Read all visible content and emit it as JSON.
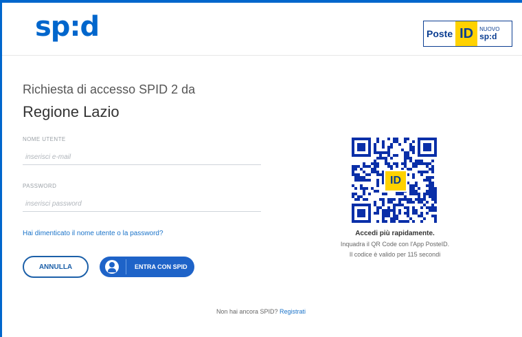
{
  "header": {
    "logo_text": "sp:d",
    "badge": {
      "poste": "Poste",
      "id": "ID",
      "nuovo": "NUOVO",
      "spid": "sp:d"
    }
  },
  "login": {
    "subtitle": "Richiesta di accesso SPID 2 da",
    "region": "Regione Lazio",
    "username_label": "NOME UTENTE",
    "username_placeholder": "inserisci e-mail",
    "password_label": "PASSWORD",
    "password_placeholder": "inserisci password",
    "forgot_link": "Hai dimenticato il nome utente o la password?",
    "cancel_label": "ANNULLA",
    "spid_button_label": "ENTRA CON SPID"
  },
  "qr": {
    "center_label": "ID",
    "title": "Accedi più rapidamente.",
    "line1": "Inquadra il QR Code con l'App PosteID.",
    "line2": "Il codice è valido per 115 secondi"
  },
  "footer": {
    "prompt": "Non hai ancora SPID?",
    "register_link": "Registrati"
  },
  "colors": {
    "primary": "#1e63c8",
    "brand_dark": "#0a3d91",
    "accent_yellow": "#ffd200"
  }
}
